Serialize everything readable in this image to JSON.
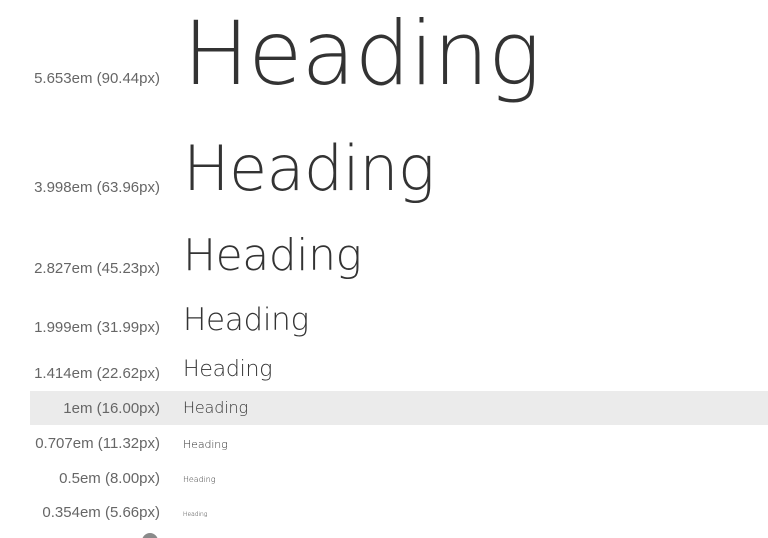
{
  "rows": [
    {
      "label": "5.653em (90.44px)",
      "sample": "Heading"
    },
    {
      "label": "3.998em (63.96px)",
      "sample": "Heading"
    },
    {
      "label": "2.827em (45.23px)",
      "sample": "Heading"
    },
    {
      "label": "1.999em (31.99px)",
      "sample": "Heading"
    },
    {
      "label": "1.414em (22.62px)",
      "sample": "Heading"
    },
    {
      "label": "1em (16.00px)",
      "sample": "Heading"
    },
    {
      "label": "0.707em (11.32px)",
      "sample": "Heading"
    },
    {
      "label": "0.5em (8.00px)",
      "sample": "Heading"
    },
    {
      "label": "0.354em (5.66px)",
      "sample": "Heading"
    }
  ],
  "colors": {
    "label": "#666666",
    "sample": "#333333",
    "highlight_row": "#ebebeb"
  }
}
